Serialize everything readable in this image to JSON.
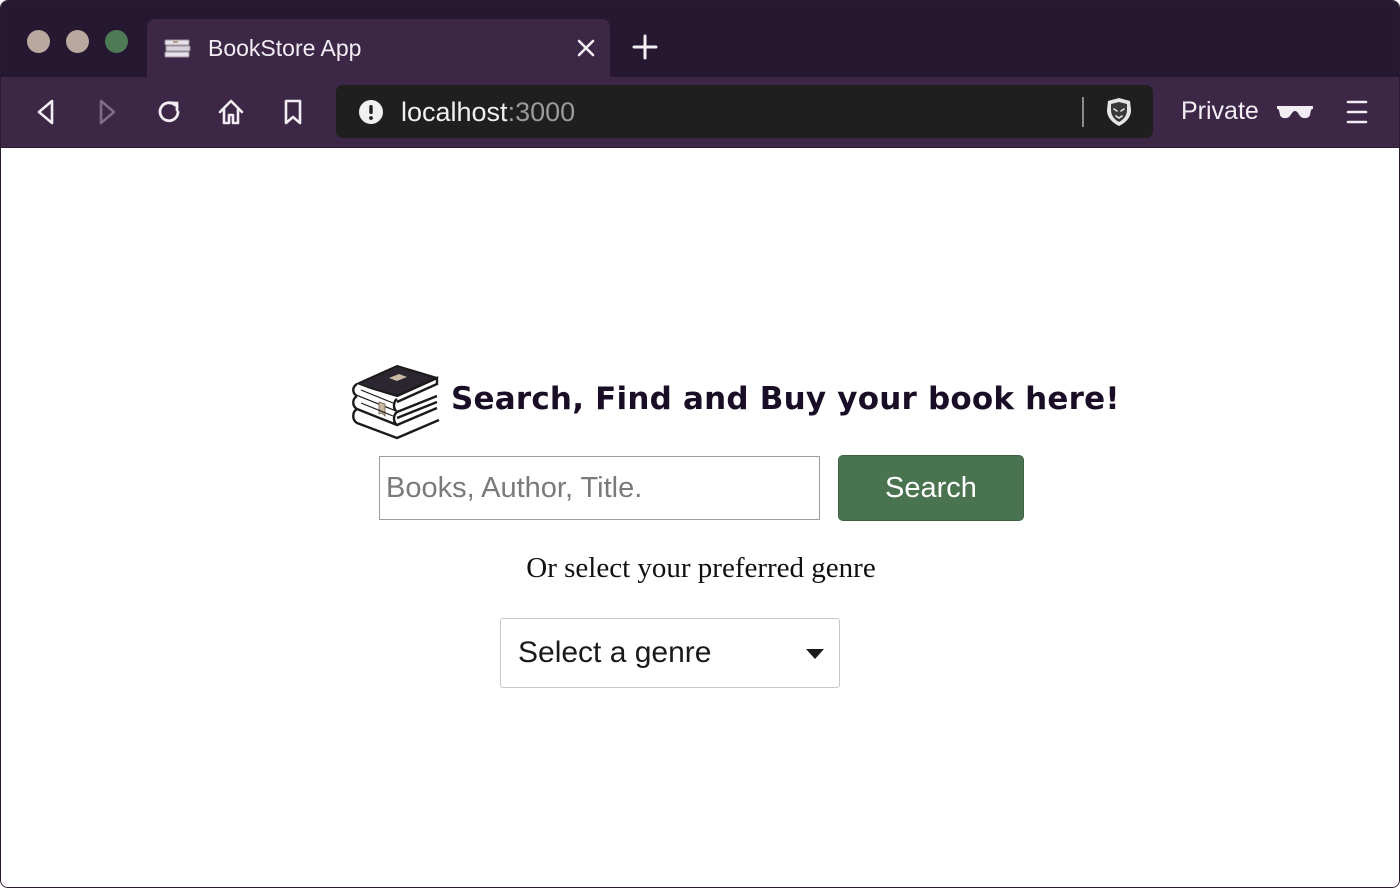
{
  "browser": {
    "tab_title": "BookStore App",
    "url_host": "localhost",
    "url_port": ":3000",
    "private_label": "Private",
    "accent_colors": {
      "titlebar": "#261830",
      "toolbar": "#3c2746",
      "urlbar": "#1f1f1f"
    },
    "icons": {
      "tab_favicon": "books-icon",
      "close_tab": "close-icon",
      "new_tab": "plus-icon",
      "back": "back-arrow-icon",
      "forward": "forward-arrow-icon",
      "reload": "reload-icon",
      "home": "home-icon",
      "bookmark": "bookmark-icon",
      "site_info": "info-icon",
      "shields": "brave-lion-icon",
      "private": "private-glasses-icon",
      "menu": "hamburger-menu-icon"
    }
  },
  "page": {
    "heading": "Search, Find and Buy your book here!",
    "search": {
      "placeholder": "Books, Author, Title.",
      "value": "",
      "button_label": "Search",
      "button_color": "#4a7350"
    },
    "genre_prompt": "Or select your preferred genre",
    "genre_select": {
      "selected": "Select a genre"
    },
    "logo_icon": "stacked-books-icon"
  }
}
